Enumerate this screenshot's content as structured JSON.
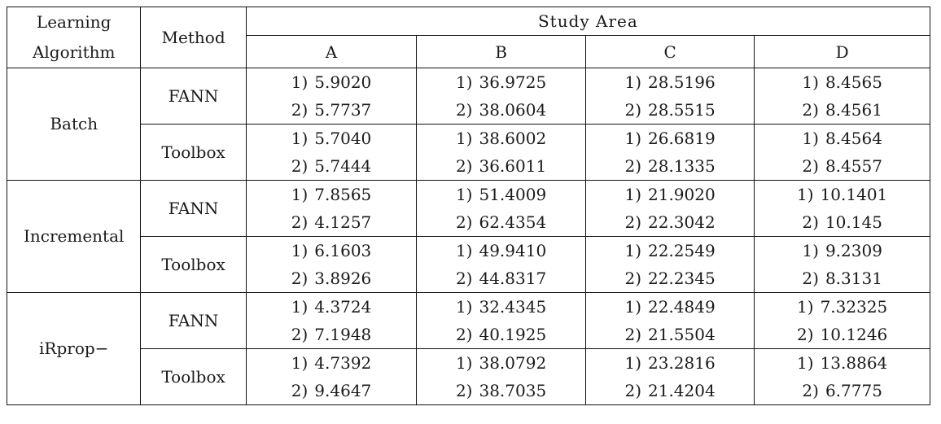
{
  "table": {
    "header": {
      "learning_algorithm": [
        "Learning",
        "Algorithm"
      ],
      "method": "Method",
      "study_area": "Study Area",
      "areas": [
        "A",
        "B",
        "C",
        "D"
      ]
    },
    "groups": [
      {
        "algorithm": "Batch",
        "methods": [
          {
            "name": "FANN",
            "values": [
              [
                {
                  "idx": "1)",
                  "v": "5.9020"
                },
                {
                  "idx": "2)",
                  "v": "5.7737"
                }
              ],
              [
                {
                  "idx": "1)",
                  "v": "36.9725"
                },
                {
                  "idx": "2)",
                  "v": "38.0604"
                }
              ],
              [
                {
                  "idx": "1)",
                  "v": "28.5196"
                },
                {
                  "idx": "2)",
                  "v": "28.5515"
                }
              ],
              [
                {
                  "idx": "1)",
                  "v": "8.4565"
                },
                {
                  "idx": "2)",
                  "v": "8.4561"
                }
              ]
            ]
          },
          {
            "name": "Toolbox",
            "values": [
              [
                {
                  "idx": "1)",
                  "v": "5.7040"
                },
                {
                  "idx": "2)",
                  "v": "5.7444"
                }
              ],
              [
                {
                  "idx": "1)",
                  "v": "38.6002"
                },
                {
                  "idx": "2)",
                  "v": "36.6011"
                }
              ],
              [
                {
                  "idx": "1)",
                  "v": "26.6819"
                },
                {
                  "idx": "2)",
                  "v": "28.1335"
                }
              ],
              [
                {
                  "idx": "1)",
                  "v": "8.4564"
                },
                {
                  "idx": "2)",
                  "v": "8.4557"
                }
              ]
            ]
          }
        ]
      },
      {
        "algorithm": "Incremental",
        "methods": [
          {
            "name": "FANN",
            "values": [
              [
                {
                  "idx": "1)",
                  "v": "7.8565"
                },
                {
                  "idx": "2)",
                  "v": "4.1257"
                }
              ],
              [
                {
                  "idx": "1)",
                  "v": "51.4009"
                },
                {
                  "idx": "2)",
                  "v": "62.4354"
                }
              ],
              [
                {
                  "idx": "1)",
                  "v": "21.9020"
                },
                {
                  "idx": "2)",
                  "v": "22.3042"
                }
              ],
              [
                {
                  "idx": "1)",
                  "v": "10.1401"
                },
                {
                  "idx": "2)",
                  "v": "10.145"
                }
              ]
            ]
          },
          {
            "name": "Toolbox",
            "values": [
              [
                {
                  "idx": "1)",
                  "v": "6.1603"
                },
                {
                  "idx": "2)",
                  "v": "3.8926"
                }
              ],
              [
                {
                  "idx": "1)",
                  "v": "49.9410"
                },
                {
                  "idx": "2)",
                  "v": "44.8317"
                }
              ],
              [
                {
                  "idx": "1)",
                  "v": "22.2549"
                },
                {
                  "idx": "2)",
                  "v": "22.2345"
                }
              ],
              [
                {
                  "idx": "1)",
                  "v": "9.2309"
                },
                {
                  "idx": "2)",
                  "v": "8.3131"
                }
              ]
            ]
          }
        ]
      },
      {
        "algorithm": "iRprop−",
        "methods": [
          {
            "name": "FANN",
            "values": [
              [
                {
                  "idx": "1)",
                  "v": "4.3724"
                },
                {
                  "idx": "2)",
                  "v": "7.1948"
                }
              ],
              [
                {
                  "idx": "1)",
                  "v": "32.4345"
                },
                {
                  "idx": "2)",
                  "v": "40.1925"
                }
              ],
              [
                {
                  "idx": "1)",
                  "v": "22.4849"
                },
                {
                  "idx": "2)",
                  "v": "21.5504"
                }
              ],
              [
                {
                  "idx": "1)",
                  "v": "7.32325"
                },
                {
                  "idx": "2)",
                  "v": "10.1246"
                }
              ]
            ]
          },
          {
            "name": "Toolbox",
            "values": [
              [
                {
                  "idx": "1)",
                  "v": "4.7392"
                },
                {
                  "idx": "2)",
                  "v": "9.4647"
                }
              ],
              [
                {
                  "idx": "1)",
                  "v": "38.0792"
                },
                {
                  "idx": "2)",
                  "v": "38.7035"
                }
              ],
              [
                {
                  "idx": "1)",
                  "v": "23.2816"
                },
                {
                  "idx": "2)",
                  "v": "21.4204"
                }
              ],
              [
                {
                  "idx": "1)",
                  "v": "13.8864"
                },
                {
                  "idx": "2)",
                  "v": "6.7775"
                }
              ]
            ]
          }
        ]
      }
    ]
  }
}
